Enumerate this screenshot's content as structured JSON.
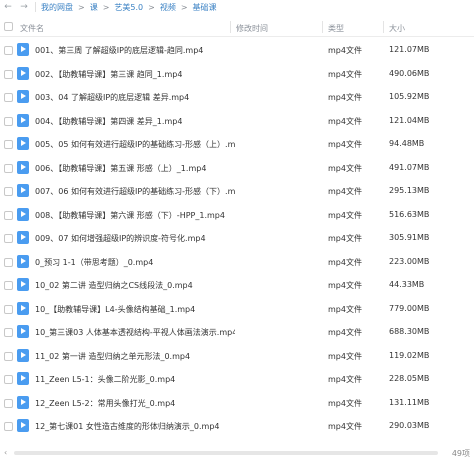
{
  "breadcrumb": {
    "items": [
      "我的网盘",
      "课",
      "艺美5.0",
      "视频",
      "基础课"
    ],
    "separator": ">"
  },
  "header": {
    "name": "文件名",
    "date": "修改时间",
    "type": "类型",
    "size": "大小"
  },
  "files": [
    {
      "name": "001、第三周 了解超级IP的底层逻辑-趋同.mp4",
      "type": "mp4文件",
      "size": "121.07MB"
    },
    {
      "name": "002、【助教辅导课】第三课 趋同_1.mp4",
      "type": "mp4文件",
      "size": "490.06MB"
    },
    {
      "name": "003、04 了解超级IP的底层逻辑 差异.mp4",
      "type": "mp4文件",
      "size": "105.92MB"
    },
    {
      "name": "004、【助教辅导课】第四课 差异_1.mp4",
      "type": "mp4文件",
      "size": "121.04MB"
    },
    {
      "name": "005、05 如何有效进行超级IP的基础练习-形感（上）.mp4",
      "type": "mp4文件",
      "size": "94.48MB"
    },
    {
      "name": "006、【助教辅导课】第五课 形感（上）_1.mp4",
      "type": "mp4文件",
      "size": "491.07MB"
    },
    {
      "name": "007、06 如何有效进行超级IP的基础练习-形感（下）.mp4",
      "type": "mp4文件",
      "size": "295.13MB"
    },
    {
      "name": "008、【助教辅导课】第六课 形感（下）-HPP_1.mp4",
      "type": "mp4文件",
      "size": "516.63MB"
    },
    {
      "name": "009、07 如何增强超级IP的辨识度-符号化.mp4",
      "type": "mp4文件",
      "size": "305.91MB"
    },
    {
      "name": "0_预习 1-1（带思考题）_0.mp4",
      "type": "mp4文件",
      "size": "223.00MB"
    },
    {
      "name": "10_02 第二讲 造型归纳之CS线段法_0.mp4",
      "type": "mp4文件",
      "size": "44.33MB"
    },
    {
      "name": "10_【助教辅导课】L4-头像结构基础_1.mp4",
      "type": "mp4文件",
      "size": "779.00MB"
    },
    {
      "name": "10_第三课03 人体基本透视结构-平视人体画法演示.mp4",
      "type": "mp4文件",
      "size": "688.30MB"
    },
    {
      "name": "11_02 第一讲 造型归纳之单元形法_0.mp4",
      "type": "mp4文件",
      "size": "119.02MB"
    },
    {
      "name": "11_Zeen L5-1：头像二阶光影_0.mp4",
      "type": "mp4文件",
      "size": "228.05MB"
    },
    {
      "name": "12_Zeen L5-2：常用头像打光_0.mp4",
      "type": "mp4文件",
      "size": "131.11MB"
    },
    {
      "name": "12_第七课01 女性造古维度的形体归纳演示_0.mp4",
      "type": "mp4文件",
      "size": "290.03MB"
    }
  ],
  "footer": {
    "count": "49项",
    "scroll_left_icon": "chevron-left-icon"
  },
  "colors": {
    "link": "#3b82c4",
    "file_icon": "#4a9cf0",
    "muted": "#8a9099"
  }
}
